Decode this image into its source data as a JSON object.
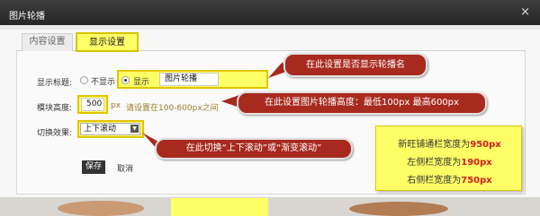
{
  "dialog": {
    "title": "图片轮播",
    "close_glyph": "×"
  },
  "tabs": [
    {
      "label": "内容设置",
      "active": false
    },
    {
      "label": "显示设置",
      "active": true
    }
  ],
  "form": {
    "display_title": {
      "label": "显示标题:",
      "options": [
        "不显示",
        "显示"
      ],
      "selected": "显示",
      "value": "图片轮播"
    },
    "module_height": {
      "label": "模块高度:",
      "value": "500",
      "unit": "px",
      "hint": "请设置在100-600px之间"
    },
    "switch_effect": {
      "label": "切换效果:",
      "selected": "上下滚动",
      "arrow_glyph": "▼"
    },
    "save_label": "保存",
    "cancel_label": "取消"
  },
  "callouts": {
    "title_tip": "在此设置是否显示轮播名",
    "height_tip": "在此设置图片轮播高度：最低100px 最高600px",
    "effect_tip": "在此切换“上下滚动”或“渐变滚动”"
  },
  "note": {
    "line1_prefix": "新旺铺通栏宽度为",
    "line1_value": "950px",
    "line2_prefix": "左侧栏宽度为",
    "line2_value": "190px",
    "line3_prefix": "右侧栏宽度为",
    "line3_value": "750px"
  },
  "colors": {
    "highlight": "#ffff66",
    "callout": "#a82a1f",
    "note_value": "#d81b1b",
    "title_bar": "#2f2f2f"
  }
}
